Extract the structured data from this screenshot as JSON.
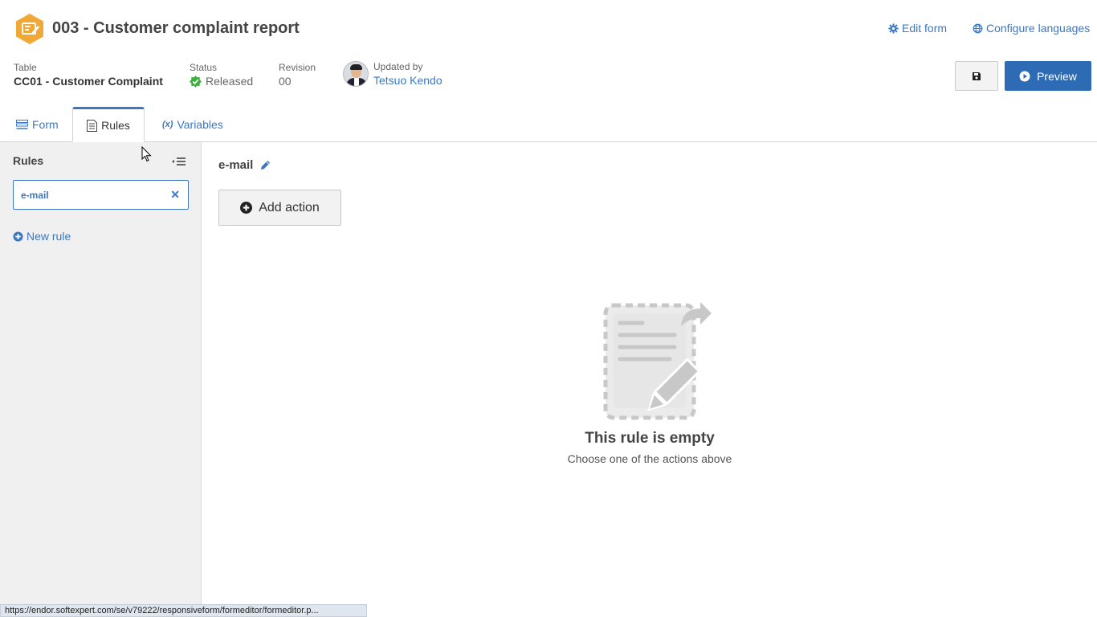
{
  "header": {
    "title": "003 - Customer complaint report",
    "edit_form": "Edit form",
    "configure_languages": "Configure languages",
    "preview_label": "Preview"
  },
  "meta": {
    "table_label": "Table",
    "table_value": "CC01 - Customer Complaint",
    "status_label": "Status",
    "status_value": "Released",
    "revision_label": "Revision",
    "revision_value": "00",
    "updated_label": "Updated by",
    "updated_value": "Tetsuo Kendo"
  },
  "tabs": [
    {
      "label": "Form",
      "icon": "form-list-icon"
    },
    {
      "label": "Rules",
      "icon": "document-icon"
    },
    {
      "label": "Variables",
      "icon": "variable-x-icon"
    }
  ],
  "sidebar": {
    "title": "Rules",
    "search_value": "e-mail",
    "new_rule": "New rule"
  },
  "main": {
    "rule_name": "e-mail",
    "add_action": "Add action",
    "empty_title": "This rule is empty",
    "empty_subtitle": "Choose one of the actions above"
  },
  "statusbar": {
    "url": "https://endor.softexpert.com/se/v79222/responsiveform/formeditor/formeditor.p..."
  },
  "colors": {
    "accent": "#3a78c3",
    "primary_button": "#2d6bb5",
    "app_icon": "#f0a836",
    "status_ok": "#3cae3c"
  }
}
